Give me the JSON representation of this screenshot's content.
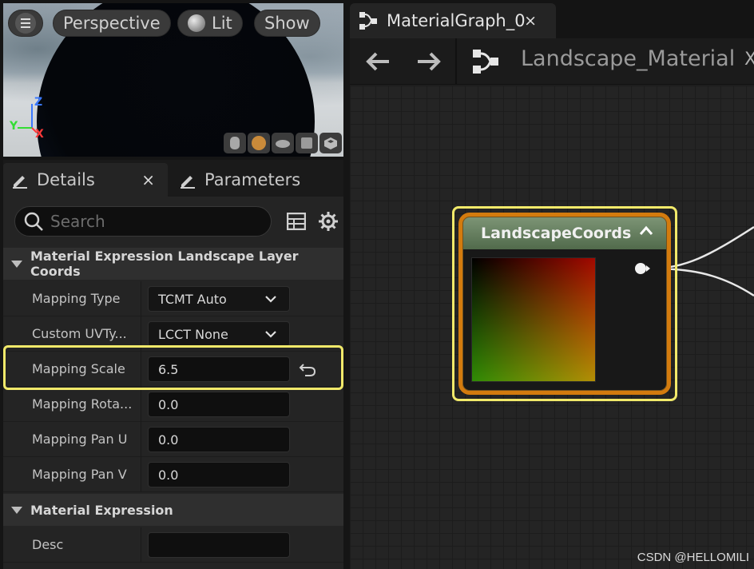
{
  "viewport": {
    "buttons": {
      "perspective": "Perspective",
      "lit": "Lit",
      "show": "Show"
    },
    "axis": {
      "z": "Z",
      "y": "Y",
      "x": "X"
    },
    "preview_shapes": [
      "cylinder-icon",
      "sphere-icon",
      "plane-icon",
      "cube-icon",
      "custom-mesh-icon"
    ]
  },
  "details": {
    "tabs": [
      {
        "label": "Details"
      },
      {
        "label": "Parameters"
      }
    ],
    "close_glyph": "×",
    "search": {
      "placeholder": "Search",
      "value": ""
    },
    "sections": [
      {
        "title": "Material Expression Landscape Layer Coords",
        "properties": [
          {
            "label": "Mapping Type",
            "value": "TCMT Auto",
            "kind": "dropdown"
          },
          {
            "label": "Custom UVTy...",
            "value": "LCCT None",
            "kind": "dropdown"
          },
          {
            "label": "Mapping Scale",
            "value": "6.5",
            "kind": "number",
            "highlighted": true
          },
          {
            "label": "Mapping Rota...",
            "value": "0.0",
            "kind": "number"
          },
          {
            "label": "Mapping Pan U",
            "value": "0.0",
            "kind": "number"
          },
          {
            "label": "Mapping Pan V",
            "value": "0.0",
            "kind": "number"
          }
        ]
      },
      {
        "title": "Material Expression",
        "properties": [
          {
            "label": "Desc",
            "value": "",
            "kind": "text"
          }
        ]
      }
    ]
  },
  "graph": {
    "tab": {
      "label": "MaterialGraph_0",
      "close_glyph": "×"
    },
    "breadcrumb": {
      "title": "Landscape_Material",
      "tail": "X"
    },
    "node": {
      "title": "LandscapeCoords",
      "header_color": "#6b8464",
      "border_color": "#d37b0e",
      "selection_color": "#f1e96a"
    }
  },
  "watermark": "CSDN @HELLOMILI"
}
